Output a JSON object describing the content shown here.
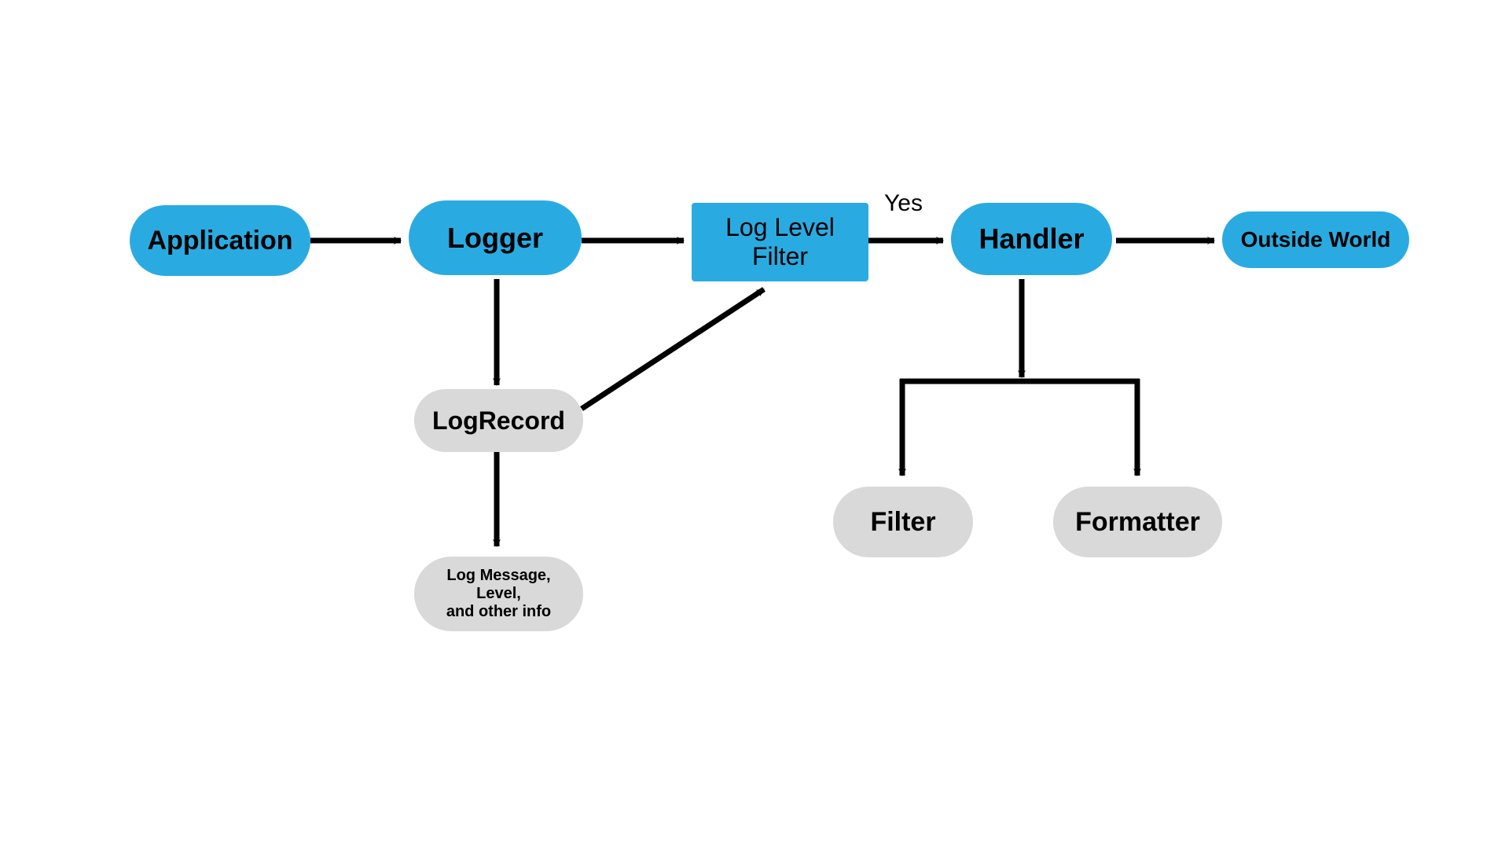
{
  "nodes": {
    "application": {
      "label": "Application"
    },
    "logger": {
      "label": "Logger"
    },
    "loglevelfilter": {
      "label": "Log Level\nFilter"
    },
    "handler": {
      "label": "Handler"
    },
    "outsideworld": {
      "label": "Outside World"
    },
    "logrecord": {
      "label": "LogRecord"
    },
    "loginfo": {
      "label": "Log Message, Level,\nand other info"
    },
    "filter": {
      "label": "Filter"
    },
    "formatter": {
      "label": "Formatter"
    }
  },
  "edgeLabels": {
    "yes": "Yes"
  },
  "colors": {
    "blue": "#29abe2",
    "grey": "#d9d9d9",
    "arrow": "#000000"
  }
}
